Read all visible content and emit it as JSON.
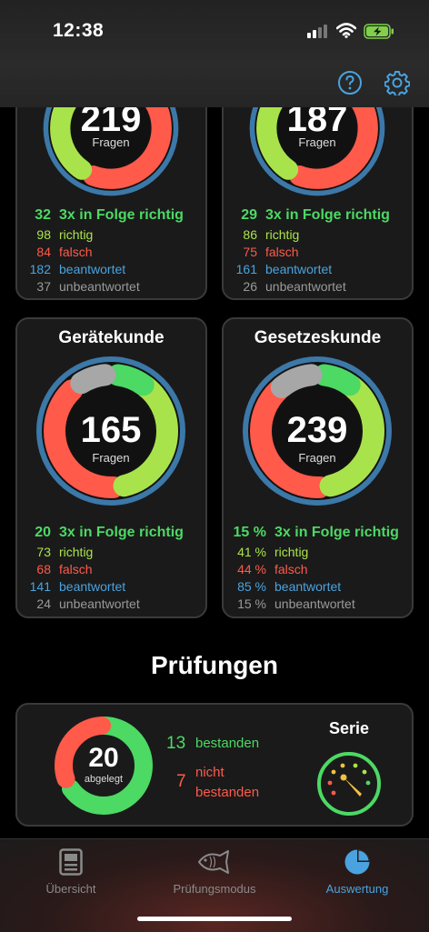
{
  "status_bar": {
    "time": "12:38"
  },
  "colors": {
    "green": "#4cd964",
    "lime": "#a9e34b",
    "red": "#ff5a4a",
    "blue": "#4aa3df",
    "gray": "#9a9a9a"
  },
  "cards_top": [
    {
      "center_number": "219",
      "center_label": "Fragen",
      "stats": {
        "streak": "32",
        "streak_label": "3x in Folge richtig",
        "right": "98",
        "right_label": "richtig",
        "wrong": "84",
        "wrong_label": "falsch",
        "answered": "182",
        "answered_label": "beantwortet",
        "unanswered": "37",
        "unanswered_label": "unbeantwortet"
      }
    },
    {
      "center_number": "187",
      "center_label": "Fragen",
      "stats": {
        "streak": "29",
        "streak_label": "3x in Folge richtig",
        "right": "86",
        "right_label": "richtig",
        "wrong": "75",
        "wrong_label": "falsch",
        "answered": "161",
        "answered_label": "beantwortet",
        "unanswered": "26",
        "unanswered_label": "unbeantwortet"
      }
    }
  ],
  "cards_mid": [
    {
      "title": "Gerätekunde",
      "center_number": "165",
      "center_label": "Fragen",
      "stats": {
        "streak": "20",
        "streak_label": "3x in Folge richtig",
        "right": "73",
        "right_label": "richtig",
        "wrong": "68",
        "wrong_label": "falsch",
        "answered": "141",
        "answered_label": "beantwortet",
        "unanswered": "24",
        "unanswered_label": "unbeantwortet"
      }
    },
    {
      "title": "Gesetzeskunde",
      "center_number": "239",
      "center_label": "Fragen",
      "stats": {
        "streak": "15 %",
        "streak_label": "3x in Folge richtig",
        "right": "41 %",
        "right_label": "richtig",
        "wrong": "44 %",
        "wrong_label": "falsch",
        "answered": "85 %",
        "answered_label": "beantwortet",
        "unanswered": "15 %",
        "unanswered_label": "unbeantwortet"
      }
    }
  ],
  "exams": {
    "section_title": "Prüfungen",
    "center_number": "20",
    "center_label": "abgelegt",
    "passed": "13",
    "passed_label": "bestanden",
    "failed": "7",
    "failed_label_1": "nicht",
    "failed_label_2": "bestanden",
    "series_title": "Serie"
  },
  "tabs": [
    {
      "label": "Übersicht",
      "icon": "overview-icon"
    },
    {
      "label": "Prüfungsmodus",
      "icon": "fish-icon"
    },
    {
      "label": "Auswertung",
      "icon": "pie-chart-icon",
      "active": true
    }
  ]
}
